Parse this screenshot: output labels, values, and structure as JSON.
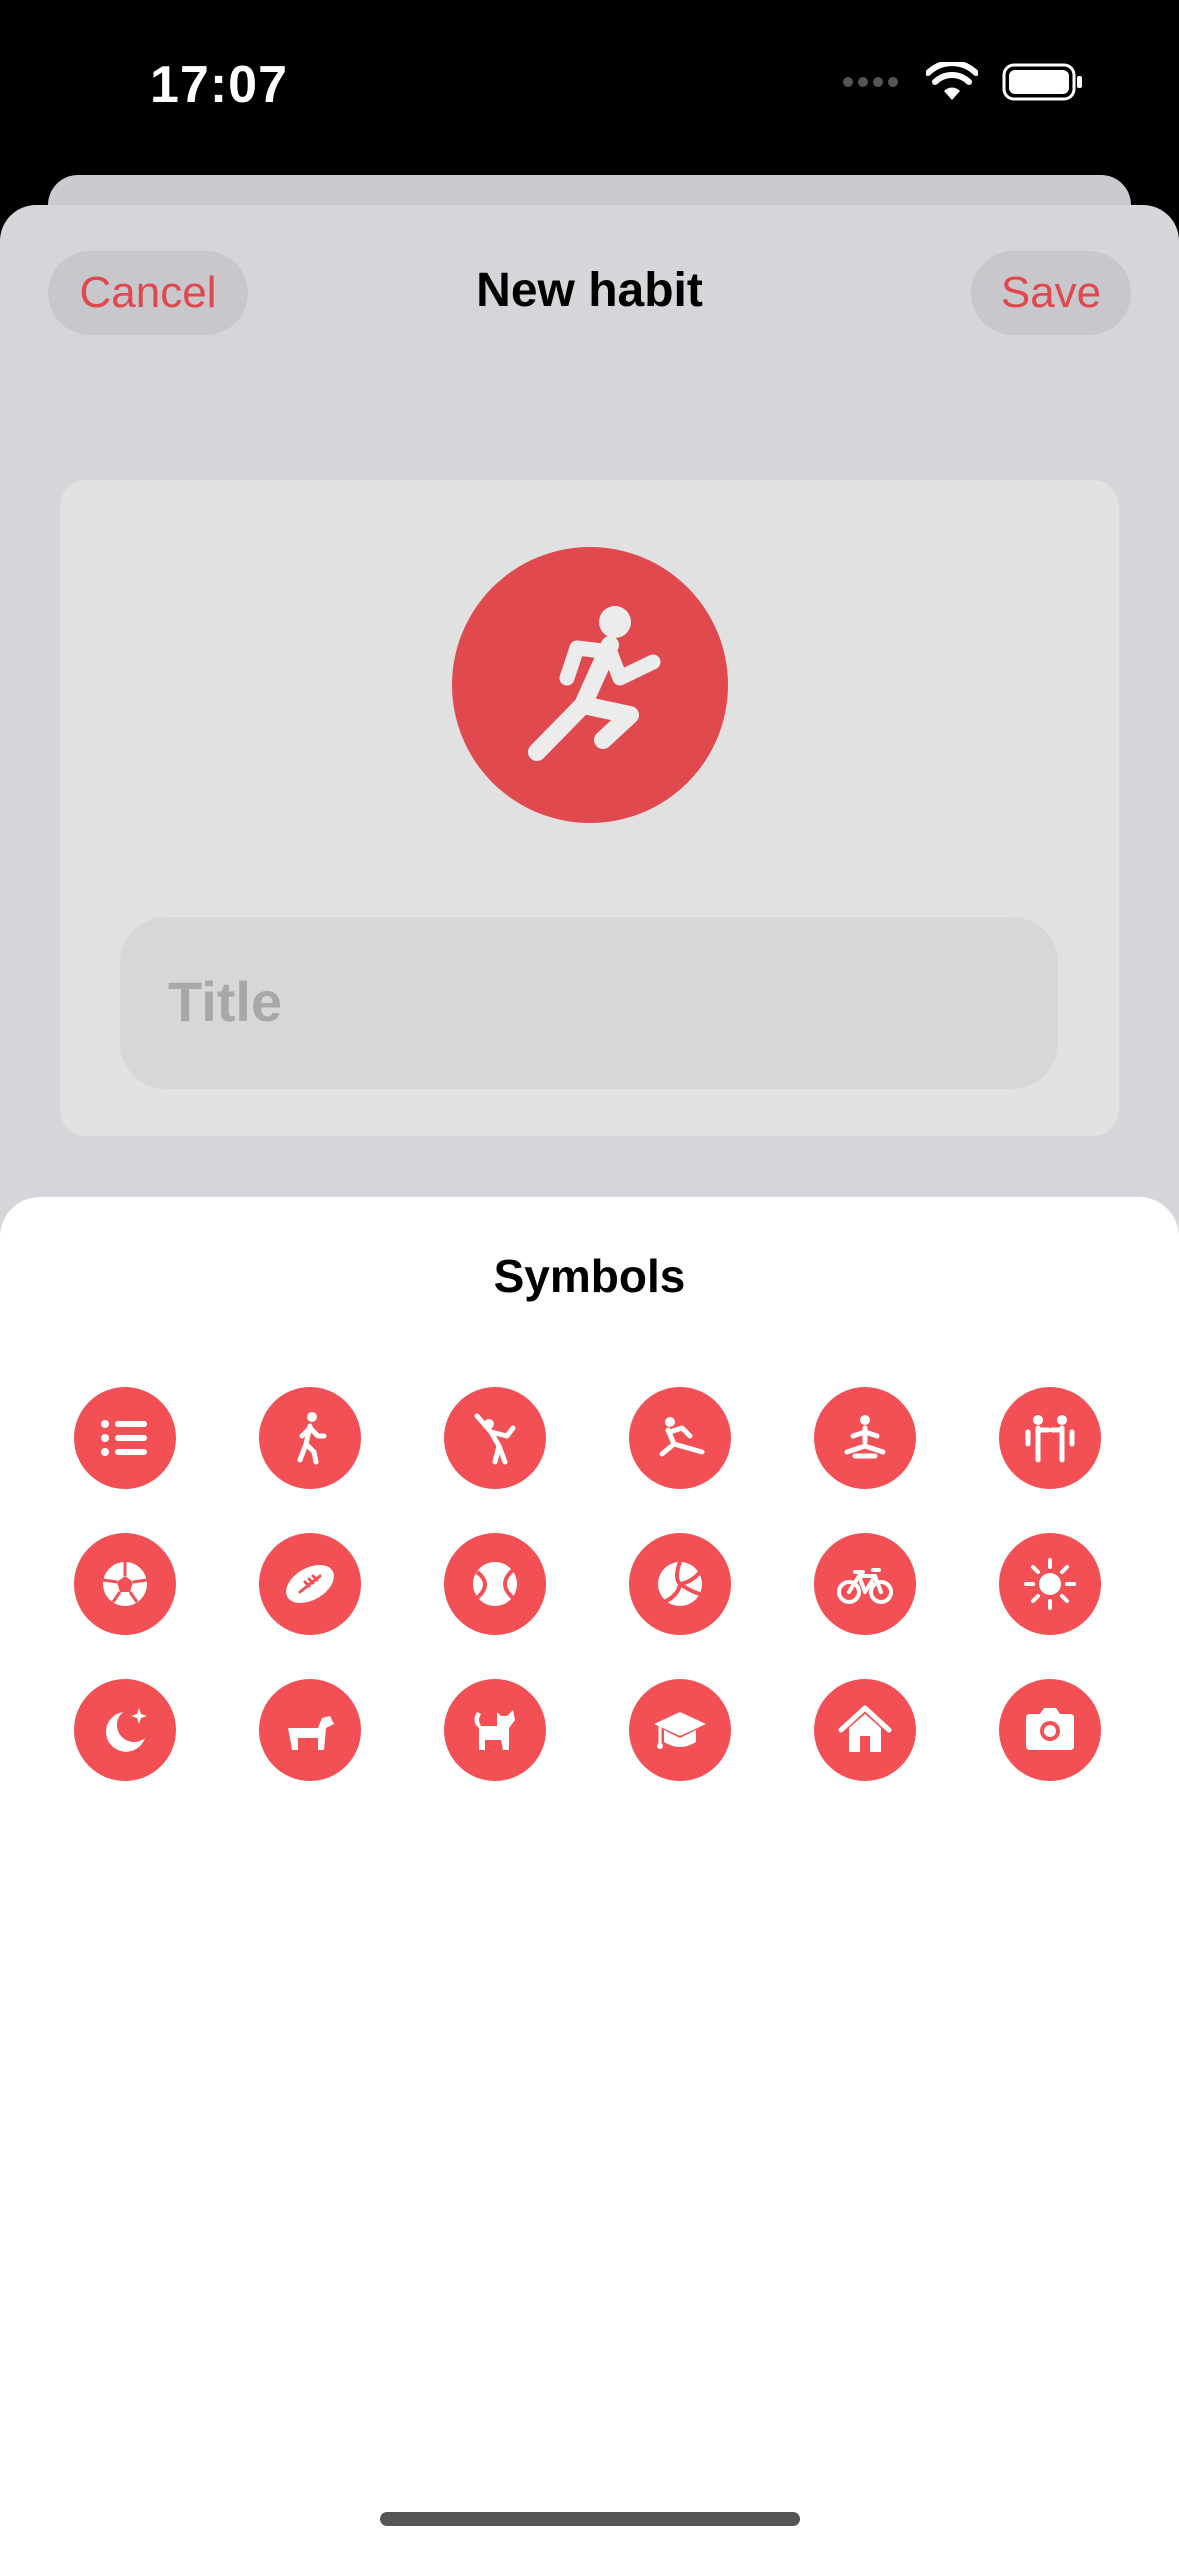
{
  "status_bar": {
    "time": "17:07",
    "icons": [
      "cellular-icon",
      "wifi-icon",
      "battery-icon"
    ]
  },
  "header": {
    "cancel_label": "Cancel",
    "title": "New habit",
    "save_label": "Save"
  },
  "form": {
    "selected_icon": "running-figure-icon",
    "title_placeholder": "Title"
  },
  "picker": {
    "title": "Symbols",
    "symbols": [
      "list-icon",
      "walking-figure-icon",
      "stretching-figure-icon",
      "yoga-stretch-icon",
      "meditation-icon",
      "two-people-icon",
      "soccer-ball-icon",
      "football-icon",
      "tennis-ball-icon",
      "volleyball-icon",
      "bicycle-icon",
      "sun-icon",
      "moon-stars-icon",
      "dog-icon",
      "cat-icon",
      "graduation-cap-icon",
      "house-icon",
      "camera-icon"
    ]
  },
  "colors": {
    "accent": "#f25054",
    "selected_icon_bg": "#e04a4f",
    "sheet_bg": "#d6d6da",
    "card_bg": "#e1e1e1"
  }
}
